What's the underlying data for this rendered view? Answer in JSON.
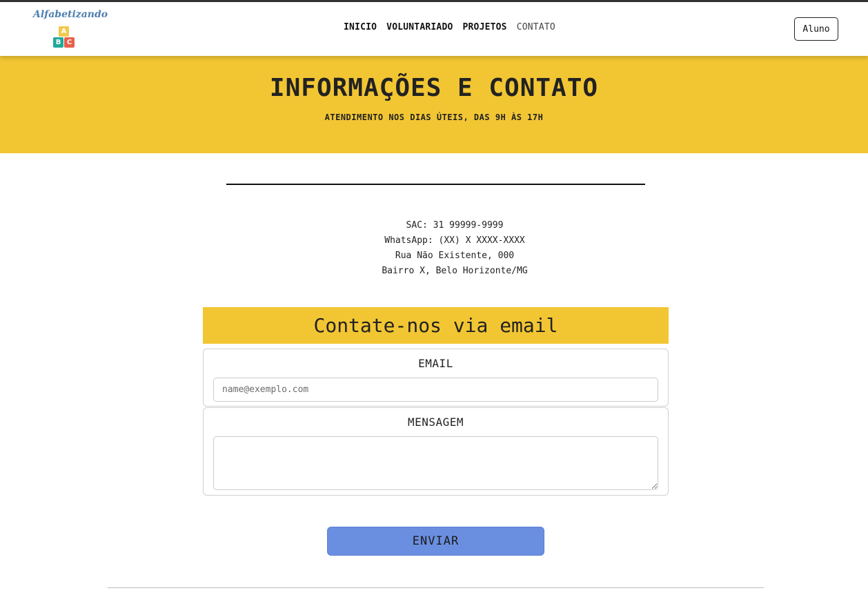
{
  "brand": {
    "logo_text": "Alfabetizando",
    "blocks": [
      "A",
      "B",
      "C"
    ],
    "block_colors": [
      "#f2c94c",
      "#21a99b",
      "#e8604c"
    ]
  },
  "nav": {
    "items": [
      {
        "label": "INICIO"
      },
      {
        "label": "VOLUNTARIADO"
      },
      {
        "label": "PROJETOS"
      },
      {
        "label": "CONTATO"
      }
    ],
    "aluno_label": "Aluno"
  },
  "hero": {
    "title": "INFORMAÇÕES E CONTATO",
    "subtitle": "ATENDIMENTO NOS DIAS ÚTEIS, DAS 9H ÀS 17H"
  },
  "contact": {
    "lines": [
      "SAC: 31 99999-9999",
      "WhatsApp: (XX) X XXXX-XXXX",
      "Rua Não Existente, 000",
      "Bairro X, Belo Horizonte/MG"
    ]
  },
  "form": {
    "title": "Contate-nos via email",
    "email_label": "EMAIL",
    "email_placeholder": "name@exemplo.com",
    "email_value": "",
    "message_label": "MENSAGEM",
    "message_value": "",
    "submit_label": "ENVIAR"
  },
  "colors": {
    "hero_bg": "#f2c633",
    "submit_bg": "#6b8fe0",
    "logo_text": "#4d7fae"
  }
}
